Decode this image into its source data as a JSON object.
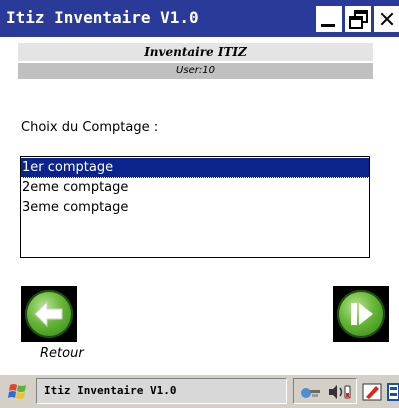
{
  "window": {
    "title": "Itiz Inventaire V1.0",
    "buttons": [
      "minimize-icon",
      "restore-icon",
      "close-icon"
    ]
  },
  "header": {
    "app_name": "Inventaire ITIZ",
    "user": "User:10"
  },
  "main": {
    "prompt": "Choix du Comptage :",
    "list": {
      "items": [
        "1er comptage",
        "2eme comptage",
        "3eme comptage"
      ],
      "selected_index": 0
    },
    "back_label": "Retour"
  },
  "taskbar": {
    "task_title": "Itiz Inventaire V1.0",
    "icons": [
      "start-icon",
      "network-icon",
      "volume-icon",
      "pen-icon",
      "keyboard-icon"
    ]
  },
  "colors": {
    "titlebar": "#2a3a98",
    "selection": "#0b238c",
    "button_green": "#63b333",
    "taskbar": "#d4d0c8"
  }
}
